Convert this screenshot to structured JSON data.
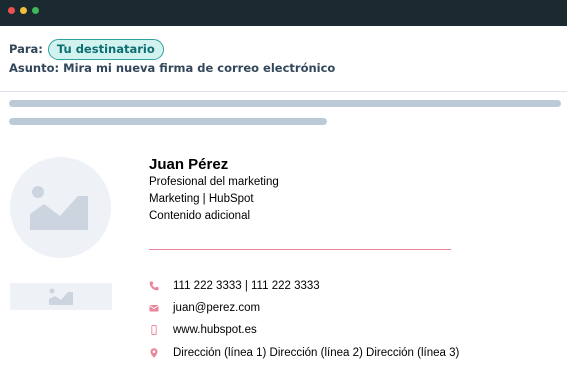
{
  "window": {
    "controls": [
      "close",
      "minimize",
      "maximize"
    ]
  },
  "email": {
    "to_label": "Para:",
    "recipient": "Tu destinatario",
    "subject_label": "Asunto:",
    "subject": "Mira mi nueva firma de correo electrónico"
  },
  "signature": {
    "name": "Juan Pérez",
    "job_title": "Profesional del marketing",
    "company": "Marketing | HubSpot",
    "additional": "Contenido adicional",
    "contacts": {
      "phone": "111 222 3333 | 111 222 3333",
      "email": "juan@perez.com",
      "website": "www.hubspot.es",
      "address": "Dirección (línea 1) Dirección (línea 2) Dirección (línea 3)"
    },
    "icons": {
      "avatar": "image-placeholder-icon",
      "logo": "image-placeholder-icon",
      "phone": "phone-icon",
      "email": "envelope-icon",
      "website": "mobile-icon",
      "address": "location-pin-icon"
    }
  },
  "colors": {
    "titlebar": "#1b2a31",
    "accent_pink": "#e9869c",
    "pill_background": "#d2f2ef",
    "pill_border": "#2fa39b",
    "placeholder_line": "#bccad7"
  }
}
